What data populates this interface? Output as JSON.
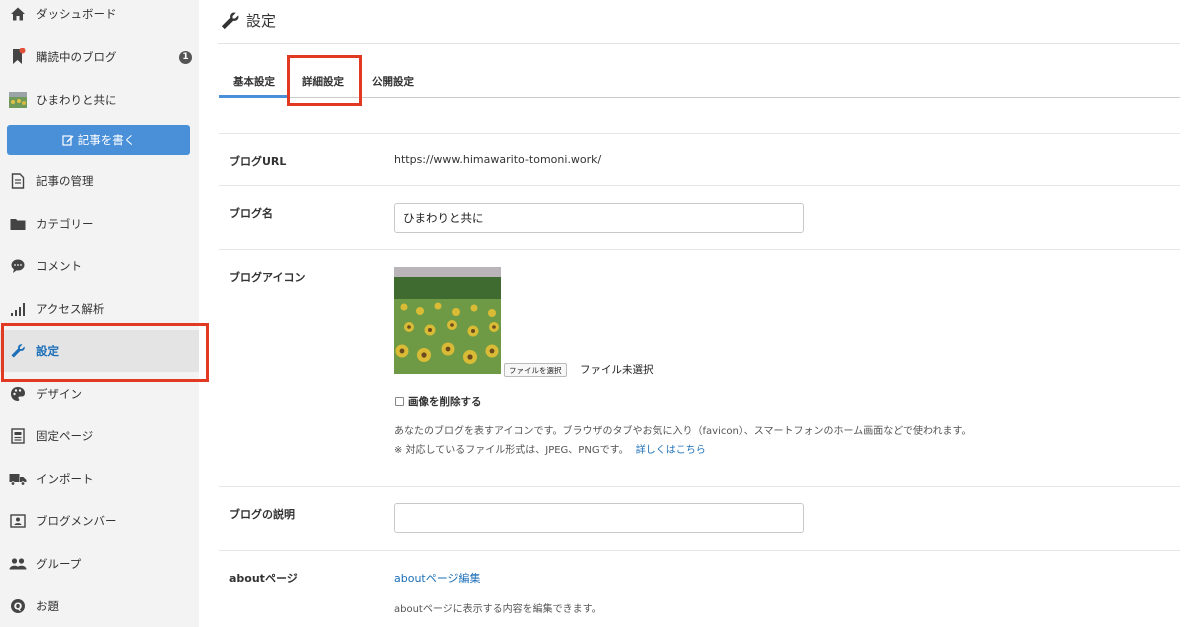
{
  "sidebar": {
    "items": [
      {
        "label": "ダッシュボード",
        "icon": "home-icon"
      },
      {
        "label": "購読中のブログ",
        "icon": "bookmark-icon",
        "badge": "1"
      },
      {
        "label": "ひまわりと共に",
        "icon": "blog-thumbnail-icon"
      },
      {
        "label": "記事の管理",
        "icon": "document-icon"
      },
      {
        "label": "カテゴリー",
        "icon": "folder-icon"
      },
      {
        "label": "コメント",
        "icon": "comment-icon"
      },
      {
        "label": "アクセス解析",
        "icon": "signal-bars-icon"
      },
      {
        "label": "設定",
        "icon": "wrench-icon",
        "active": true
      },
      {
        "label": "デザイン",
        "icon": "palette-icon"
      },
      {
        "label": "固定ページ",
        "icon": "page-icon"
      },
      {
        "label": "インポート",
        "icon": "truck-icon"
      },
      {
        "label": "ブログメンバー",
        "icon": "member-card-icon"
      },
      {
        "label": "グループ",
        "icon": "group-icon"
      },
      {
        "label": "お題",
        "icon": "question-icon"
      }
    ],
    "write_button": "記事を書く"
  },
  "header": {
    "title": "設定"
  },
  "tabs": [
    {
      "label": "基本設定",
      "active": true
    },
    {
      "label": "詳細設定"
    },
    {
      "label": "公開設定"
    }
  ],
  "form": {
    "blog_url": {
      "label": "ブログURL",
      "value": "https://www.himawarito-tomoni.work/"
    },
    "blog_name": {
      "label": "ブログ名",
      "value": "ひまわりと共に"
    },
    "blog_icon": {
      "label": "ブログアイコン",
      "file_button": "ファイルを選択",
      "file_status": "ファイル未選択",
      "delete_label": "画像を削除する",
      "help1": "あなたのブログを表すアイコンです。ブラウザのタブやお気に入り（favicon）、スマートフォンのホーム画面などで使われます。",
      "help2": "※ 対応しているファイル形式は、JPEG、PNGです。",
      "help_link": "詳しくはこちら"
    },
    "blog_description": {
      "label": "ブログの説明",
      "value": ""
    },
    "about_page": {
      "label": "aboutページ",
      "link": "aboutページ編集",
      "help": "aboutページに表示する内容を編集できます。"
    }
  },
  "colors": {
    "accent": "#4a90d9",
    "link": "#1c6fb8",
    "highlight": "#e23a22",
    "sidebar_bg": "#f3f3f3"
  }
}
